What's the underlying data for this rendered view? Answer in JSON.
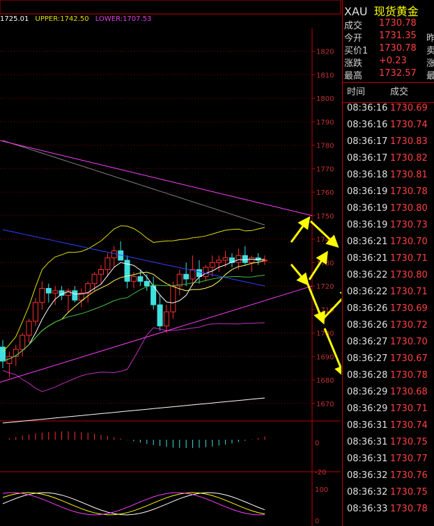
{
  "legend": {
    "mid": "1725.01",
    "upper": "UPPER:1742.50",
    "lower": "LOWER:1707.53"
  },
  "colors": {
    "up": "#ff3030",
    "down": "#40e0e0",
    "grid": "#8b0000",
    "axis": "#c00000",
    "upper_band": "#e0e000",
    "lower_band": "#c030c0",
    "trendline": "#ff40ff",
    "arrow": "#ffff00"
  },
  "quote": {
    "symbol": "XAU",
    "name": "现货黄金",
    "rows": [
      {
        "label": "成交",
        "value": "1730.78",
        "right": ""
      },
      {
        "label": "今开",
        "value": "1731.35",
        "right": "昨"
      },
      {
        "label": "买价1",
        "value": "1730.78",
        "right": "卖"
      },
      {
        "label": "涨跌",
        "value": "+0.23",
        "right": "涨"
      },
      {
        "label": "最高",
        "value": "1732.57",
        "right": "最"
      }
    ]
  },
  "ticks_header": {
    "time": "时间",
    "price": "成交"
  },
  "ticks": [
    {
      "time": "08:36:16",
      "price": "1730.69"
    },
    {
      "time": "08:36:16",
      "price": "1730.74"
    },
    {
      "time": "08:36:17",
      "price": "1730.83"
    },
    {
      "time": "08:36:17",
      "price": "1730.82"
    },
    {
      "time": "08:36:18",
      "price": "1730.81"
    },
    {
      "time": "08:36:19",
      "price": "1730.78"
    },
    {
      "time": "08:36:19",
      "price": "1730.80"
    },
    {
      "time": "08:36:19",
      "price": "1730.73"
    },
    {
      "time": "08:36:21",
      "price": "1730.70"
    },
    {
      "time": "08:36:21",
      "price": "1730.71"
    },
    {
      "time": "08:36:22",
      "price": "1730.80"
    },
    {
      "time": "08:36:22",
      "price": "1730.71"
    },
    {
      "time": "08:36:26",
      "price": "1730.69"
    },
    {
      "time": "08:36:26",
      "price": "1730.72"
    },
    {
      "time": "08:36:27",
      "price": "1730.70"
    },
    {
      "time": "08:36:27",
      "price": "1730.67"
    },
    {
      "time": "08:36:28",
      "price": "1730.78"
    },
    {
      "time": "08:36:29",
      "price": "1730.68"
    },
    {
      "time": "08:36:29",
      "price": "1730.71"
    },
    {
      "time": "08:36:31",
      "price": "1730.74"
    },
    {
      "time": "08:36:31",
      "price": "1730.75"
    },
    {
      "time": "08:36:31",
      "price": "1730.77"
    },
    {
      "time": "08:36:32",
      "price": "1730.76"
    },
    {
      "time": "08:36:32",
      "price": "1730.75"
    },
    {
      "time": "08:36:33",
      "price": "1730.78"
    }
  ],
  "chart_data": {
    "type": "candlestick",
    "title": "",
    "ylim": [
      1664,
      1830
    ],
    "yticks": [
      1820,
      1810,
      1800,
      1790,
      1780,
      1770,
      1760,
      1750,
      1740,
      1730,
      1720,
      1710,
      1700,
      1690,
      1680,
      1670
    ],
    "candles": [
      {
        "o": 1694,
        "h": 1697,
        "l": 1685,
        "c": 1688
      },
      {
        "o": 1687,
        "h": 1692,
        "l": 1681,
        "c": 1690
      },
      {
        "o": 1690,
        "h": 1695,
        "l": 1686,
        "c": 1693
      },
      {
        "o": 1693,
        "h": 1700,
        "l": 1690,
        "c": 1699
      },
      {
        "o": 1699,
        "h": 1706,
        "l": 1696,
        "c": 1705
      },
      {
        "o": 1705,
        "h": 1715,
        "l": 1703,
        "c": 1713
      },
      {
        "o": 1713,
        "h": 1722,
        "l": 1710,
        "c": 1719
      },
      {
        "o": 1719,
        "h": 1721,
        "l": 1713,
        "c": 1717
      },
      {
        "o": 1717,
        "h": 1720,
        "l": 1712,
        "c": 1718
      },
      {
        "o": 1718,
        "h": 1720,
        "l": 1714,
        "c": 1716
      },
      {
        "o": 1716,
        "h": 1719,
        "l": 1709,
        "c": 1718
      },
      {
        "o": 1718,
        "h": 1720,
        "l": 1713,
        "c": 1714
      },
      {
        "o": 1714,
        "h": 1719,
        "l": 1711,
        "c": 1717
      },
      {
        "o": 1717,
        "h": 1722,
        "l": 1713,
        "c": 1721
      },
      {
        "o": 1721,
        "h": 1726,
        "l": 1718,
        "c": 1725
      },
      {
        "o": 1725,
        "h": 1729,
        "l": 1721,
        "c": 1727
      },
      {
        "o": 1727,
        "h": 1734,
        "l": 1724,
        "c": 1732
      },
      {
        "o": 1732,
        "h": 1737,
        "l": 1728,
        "c": 1735
      },
      {
        "o": 1735,
        "h": 1739,
        "l": 1731,
        "c": 1731
      },
      {
        "o": 1731,
        "h": 1733,
        "l": 1719,
        "c": 1722
      },
      {
        "o": 1722,
        "h": 1726,
        "l": 1719,
        "c": 1724
      },
      {
        "o": 1724,
        "h": 1727,
        "l": 1720,
        "c": 1722
      },
      {
        "o": 1722,
        "h": 1725,
        "l": 1718,
        "c": 1720
      },
      {
        "o": 1720,
        "h": 1724,
        "l": 1710,
        "c": 1712
      },
      {
        "o": 1712,
        "h": 1716,
        "l": 1701,
        "c": 1703
      },
      {
        "o": 1703,
        "h": 1712,
        "l": 1700,
        "c": 1709
      },
      {
        "o": 1709,
        "h": 1722,
        "l": 1706,
        "c": 1720
      },
      {
        "o": 1720,
        "h": 1727,
        "l": 1716,
        "c": 1725
      },
      {
        "o": 1725,
        "h": 1730,
        "l": 1720,
        "c": 1723
      },
      {
        "o": 1723,
        "h": 1733,
        "l": 1720,
        "c": 1727
      },
      {
        "o": 1727,
        "h": 1731,
        "l": 1721,
        "c": 1724
      },
      {
        "o": 1724,
        "h": 1729,
        "l": 1722,
        "c": 1728
      },
      {
        "o": 1728,
        "h": 1733,
        "l": 1724,
        "c": 1730
      },
      {
        "o": 1730,
        "h": 1733,
        "l": 1726,
        "c": 1731
      },
      {
        "o": 1731,
        "h": 1735,
        "l": 1728,
        "c": 1732
      },
      {
        "o": 1732,
        "h": 1734,
        "l": 1728,
        "c": 1730
      },
      {
        "o": 1730,
        "h": 1736,
        "l": 1727,
        "c": 1733
      },
      {
        "o": 1733,
        "h": 1737,
        "l": 1729,
        "c": 1730
      },
      {
        "o": 1730,
        "h": 1733,
        "l": 1726,
        "c": 1732
      },
      {
        "o": 1732,
        "h": 1734,
        "l": 1729,
        "c": 1731
      },
      {
        "o": 1731,
        "h": 1733,
        "l": 1729,
        "c": 1731
      }
    ],
    "macd_panel": {
      "labels": [
        "0",
        "-20"
      ]
    },
    "kdj_panel": {
      "labels": [
        "100",
        "0"
      ]
    }
  }
}
